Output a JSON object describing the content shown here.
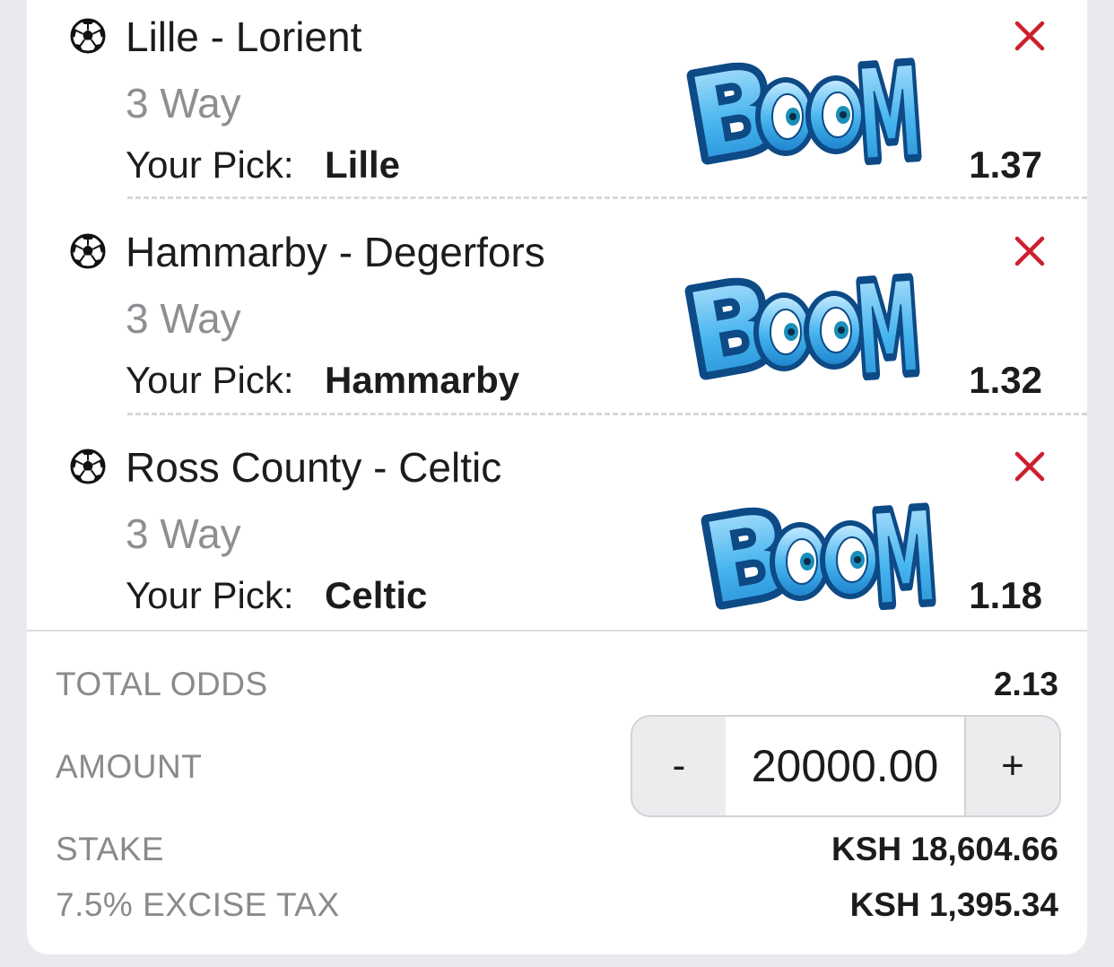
{
  "betslip": {
    "pick_label": "Your Pick:",
    "boom_text": "BOOM",
    "bets": [
      {
        "match": "Lille - Lorient",
        "market": "3 Way",
        "pick": "Lille",
        "odds": "1.37"
      },
      {
        "match": "Hammarby - Degerfors",
        "market": "3 Way",
        "pick": "Hammarby",
        "odds": "1.32"
      },
      {
        "match": "Ross County - Celtic",
        "market": "3 Way",
        "pick": "Celtic",
        "odds": "1.18"
      }
    ]
  },
  "summary": {
    "total_odds_label": "TOTAL ODDS",
    "total_odds_value": "2.13",
    "amount_label": "AMOUNT",
    "amount_value": "20000.00",
    "minus_label": "-",
    "plus_label": "+",
    "stake_label": "STAKE",
    "stake_value": "KSH 18,604.66",
    "tax_label": "7.5% EXCISE TAX",
    "tax_value": "KSH 1,395.34"
  },
  "colors": {
    "remove_icon": "#cc1f2f",
    "boom_fill": "#3aa9e6",
    "boom_outline": "#0d4a86"
  },
  "icons": {
    "sport": "soccer-ball-icon",
    "remove": "close-icon"
  }
}
